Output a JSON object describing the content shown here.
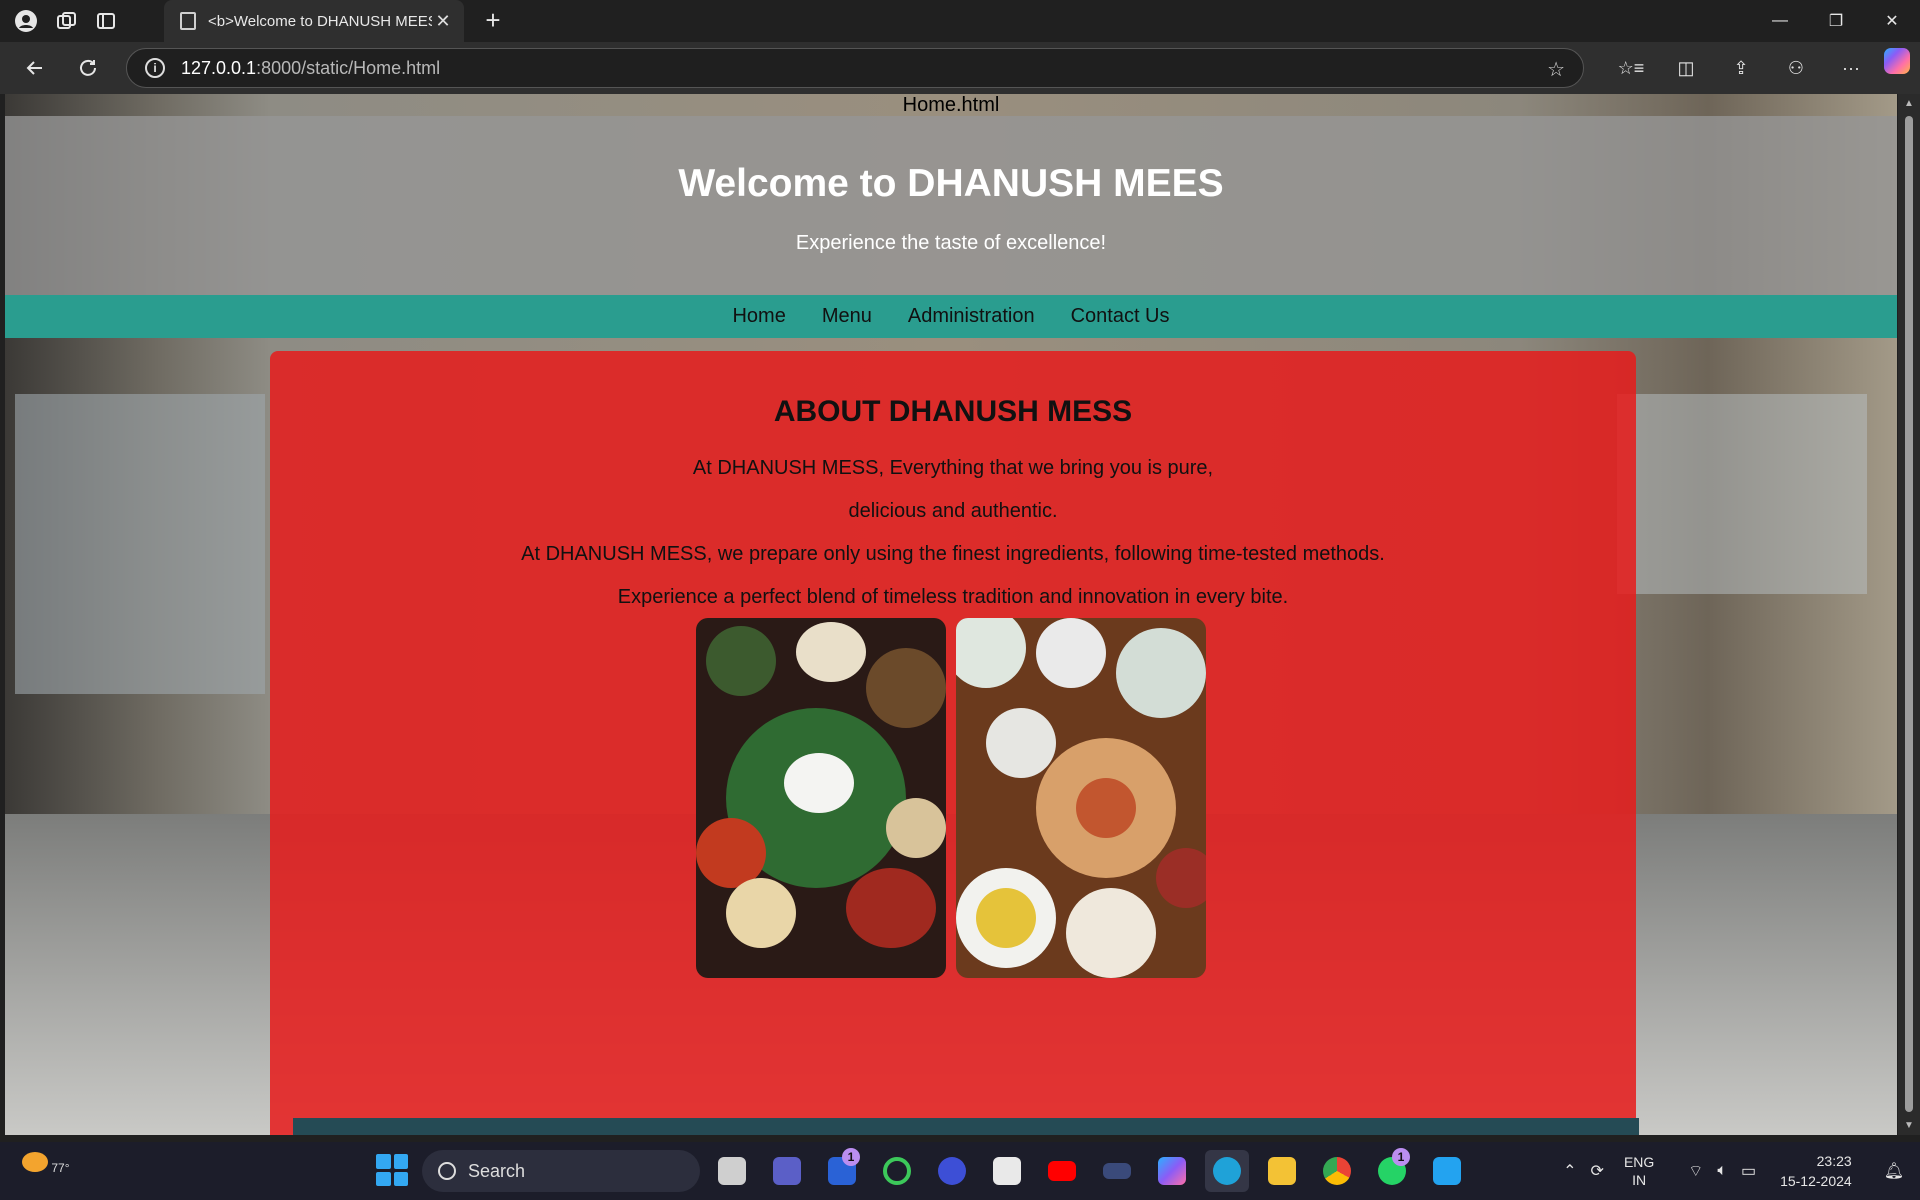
{
  "browser": {
    "tab_title": "<b>Welcome to DHANUSH MEES",
    "new_tab_label": "+",
    "url_host": "127.0.0.1",
    "url_path": ":8000/static/Home.html",
    "window_controls": [
      "—",
      "❐",
      "✕"
    ]
  },
  "page": {
    "filename": "Home.html",
    "header": {
      "title": "Welcome to DHANUSH MEES",
      "tagline": "Experience the taste of excellence!"
    },
    "nav": [
      "Home",
      "Menu",
      "Administration",
      "Contact Us"
    ],
    "about": {
      "heading": "ABOUT DHANUSH MESS",
      "lines": [
        "At DHANUSH MESS, Everything that we bring you is pure,",
        "delicious and authentic.",
        "At DHANUSH MESS, we prepare only using the finest ingredients, following time-tested methods.",
        "Experience a perfect blend of timeless tradition and innovation in every bite."
      ]
    }
  },
  "taskbar": {
    "weather": "77°",
    "search_label": "Search",
    "badges": [
      "1",
      "1"
    ],
    "language": [
      "ENG",
      "IN"
    ],
    "time": "23:23",
    "date": "15-12-2024"
  },
  "colors": {
    "header_overlay": "#969696",
    "nav_bg": "#2a9d8f",
    "about_bg": "#e61c1c",
    "footer_strip": "#254b55"
  }
}
